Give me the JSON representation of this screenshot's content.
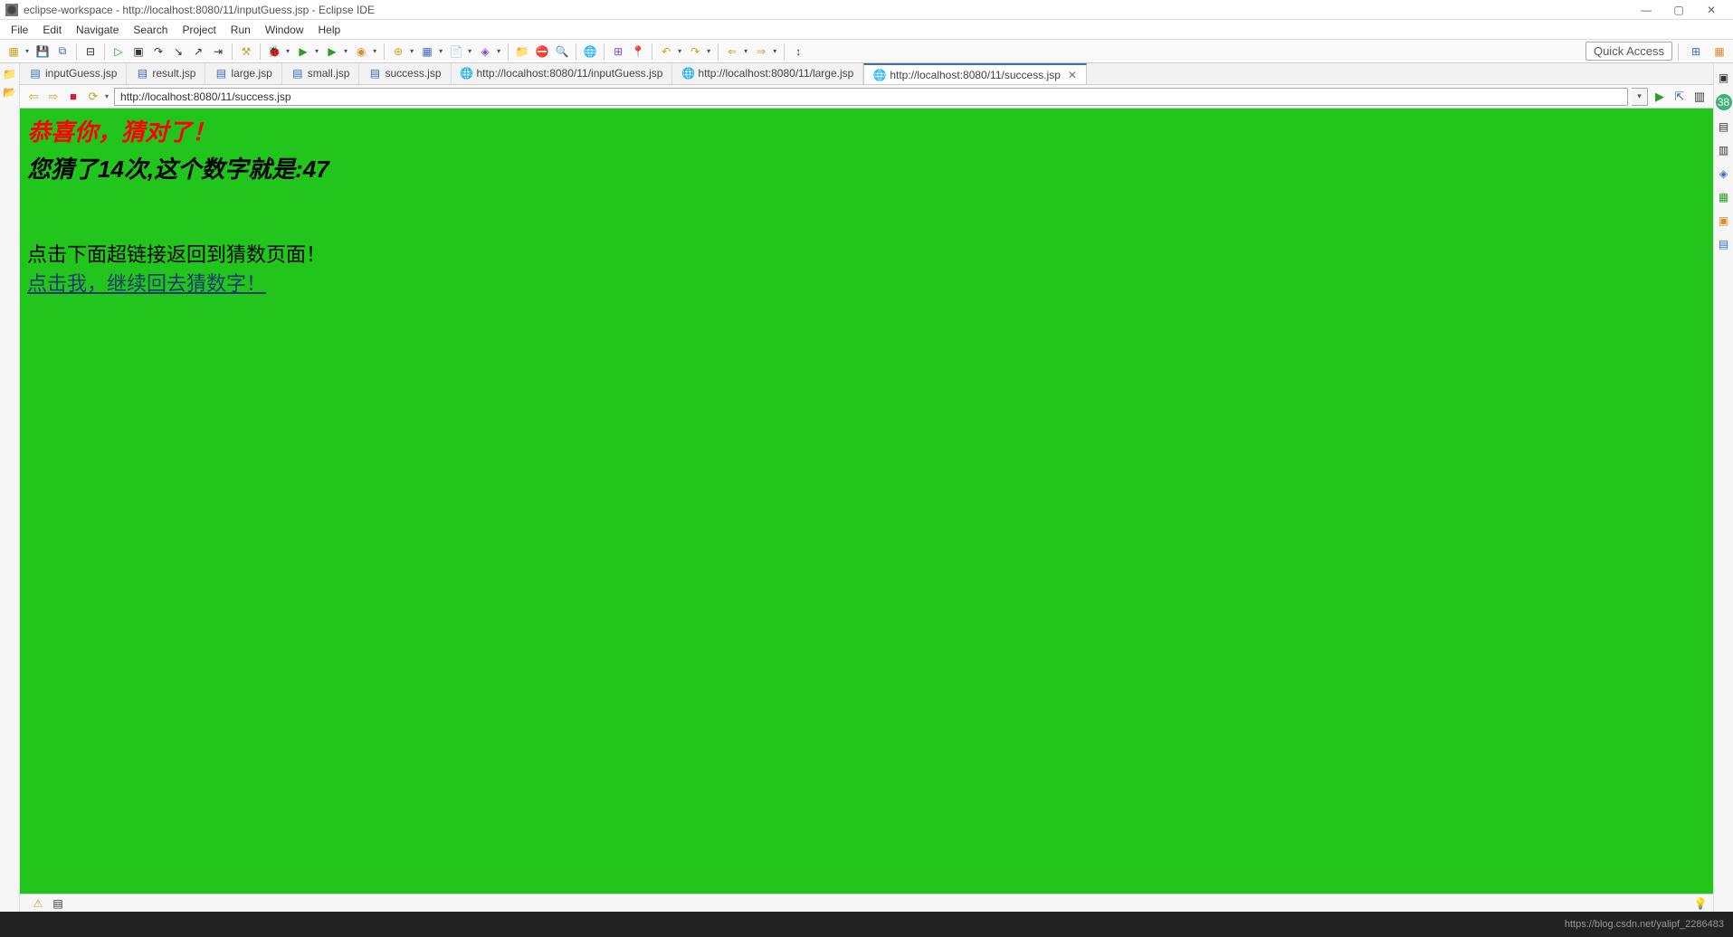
{
  "titlebar": {
    "title": "eclipse-workspace - http://localhost:8080/11/inputGuess.jsp - Eclipse IDE"
  },
  "menu": {
    "file": "File",
    "edit": "Edit",
    "navigate": "Navigate",
    "search": "Search",
    "project": "Project",
    "run": "Run",
    "window": "Window",
    "help": "Help"
  },
  "toolbar": {
    "quick_access": "Quick Access"
  },
  "editor_tabs": [
    {
      "label": "inputGuess.jsp",
      "kind": "jsp",
      "active": false
    },
    {
      "label": "result.jsp",
      "kind": "jsp",
      "active": false
    },
    {
      "label": "large.jsp",
      "kind": "jsp",
      "active": false
    },
    {
      "label": "small.jsp",
      "kind": "jsp",
      "active": false
    },
    {
      "label": "success.jsp",
      "kind": "jsp",
      "active": false
    },
    {
      "label": "http://localhost:8080/11/inputGuess.jsp",
      "kind": "web",
      "active": false
    },
    {
      "label": "http://localhost:8080/11/large.jsp",
      "kind": "web",
      "active": false
    },
    {
      "label": "http://localhost:8080/11/success.jsp",
      "kind": "web",
      "active": true
    }
  ],
  "browser": {
    "url": "http://localhost:8080/11/success.jsp"
  },
  "page": {
    "h1": "恭喜你，猜对了！",
    "h2": "您猜了14次,这个数字就是:47",
    "p1": "点击下面超链接返回到猜数页面！",
    "link": "点击我，继续回去猜数字！ "
  },
  "watermark": "https://blog.csdn.net/yalipf_2286483"
}
